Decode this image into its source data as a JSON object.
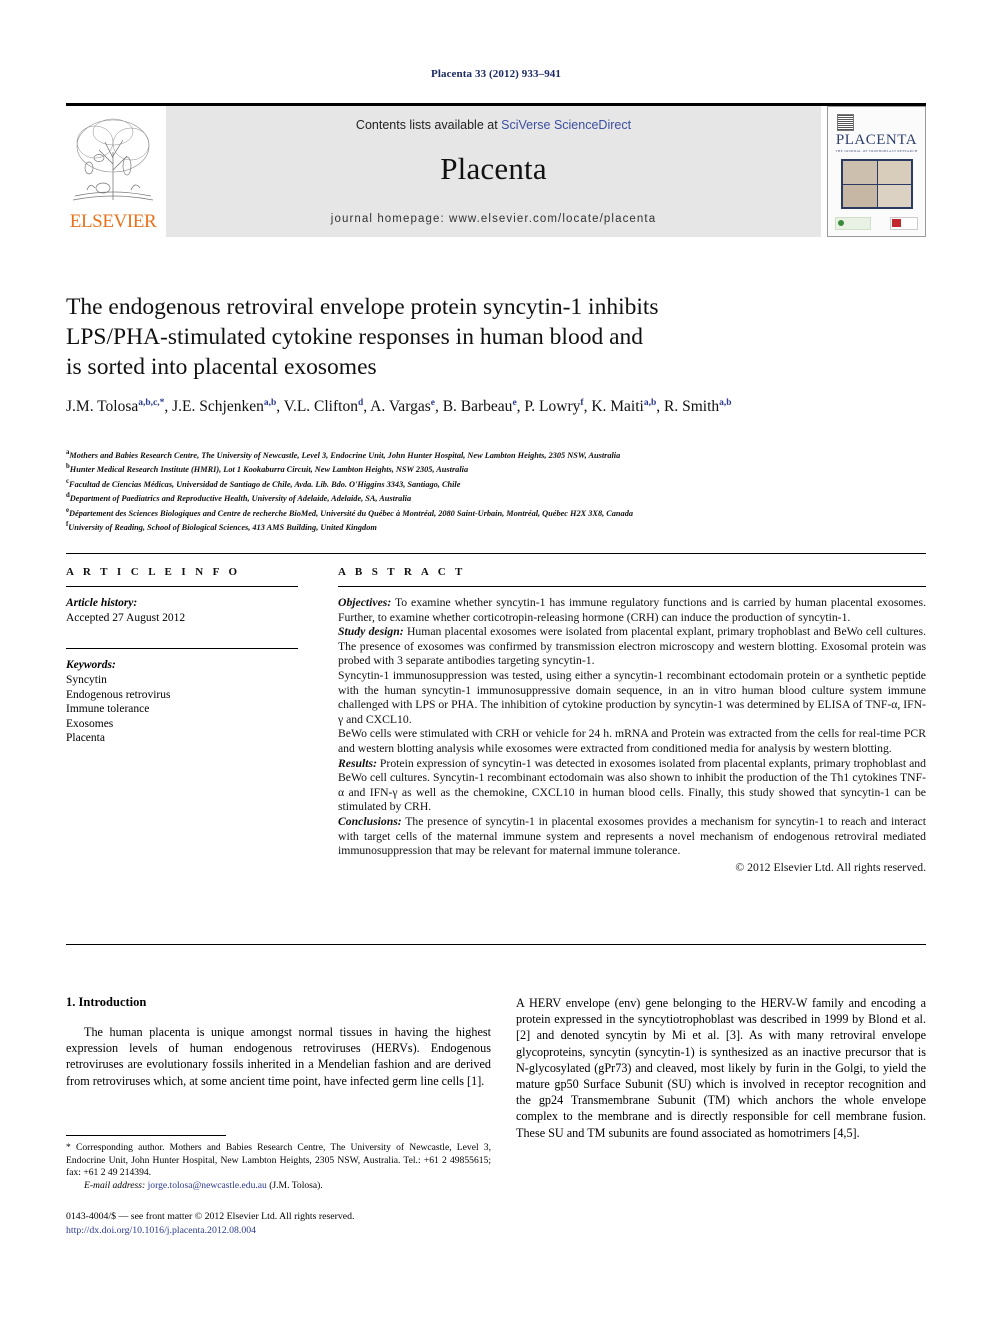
{
  "running_head": "Placenta 33 (2012) 933–941",
  "banner": {
    "publisher_name": "ELSEVIER",
    "contents_prefix": "Contents lists available at ",
    "contents_link": "SciVerse ScienceDirect",
    "journal_title": "Placenta",
    "homepage_line": "journal homepage: www.elsevier.com/locate/placenta",
    "cover_title": "PLACENTA",
    "cover_subtitle": "THE JOURNAL OF TROPHOBLAST RESEARCH"
  },
  "article": {
    "title_lines": [
      "The endogenous retroviral envelope protein syncytin-1 inhibits",
      "LPS/PHA-stimulated cytokine responses in human blood and",
      "is sorted into placental exosomes"
    ],
    "authors": [
      {
        "name": "J.M. Tolosa",
        "sup": "a,b,c,*"
      },
      {
        "name": "J.E. Schjenken",
        "sup": "a,b"
      },
      {
        "name": "V.L. Clifton",
        "sup": "d"
      },
      {
        "name": "A. Vargas",
        "sup": "e"
      },
      {
        "name": "B. Barbeau",
        "sup": "e"
      },
      {
        "name": "P. Lowry",
        "sup": "f"
      },
      {
        "name": "K. Maiti",
        "sup": "a,b"
      },
      {
        "name": "R. Smith",
        "sup": "a,b"
      }
    ],
    "affiliations": [
      {
        "mark": "a",
        "text": "Mothers and Babies Research Centre, The University of Newcastle, Level 3, Endocrine Unit, John Hunter Hospital, New Lambton Heights, 2305 NSW, Australia"
      },
      {
        "mark": "b",
        "text": "Hunter Medical Research Institute (HMRI), Lot 1 Kookaburra Circuit, New Lambton Heights, NSW 2305, Australia"
      },
      {
        "mark": "c",
        "text": "Facultad de Ciencias Médicas, Universidad de Santiago de Chile, Avda. Lib. Bdo. O'Higgins 3343, Santiago, Chile"
      },
      {
        "mark": "d",
        "text": "Department of Paediatrics and Reproductive Health, University of Adelaide, Adelaide, SA, Australia"
      },
      {
        "mark": "e",
        "text": "Département des Sciences Biologiques and Centre de recherche BioMed, Université du Québec à Montréal, 2080 Saint-Urbain, Montréal, Québec H2X 3X8, Canada"
      },
      {
        "mark": "f",
        "text": "University of Reading, School of Biological Sciences, 413 AMS Building, United Kingdom"
      }
    ]
  },
  "article_info": {
    "heading": "A R T I C L E  I N F O",
    "history_label": "Article history:",
    "history_value": "Accepted 27 August 2012",
    "keywords_label": "Keywords:",
    "keywords": [
      "Syncytin",
      "Endogenous retrovirus",
      "Immune tolerance",
      "Exosomes",
      "Placenta"
    ]
  },
  "abstract": {
    "heading": "A B S T R A C T",
    "paragraphs": [
      {
        "lead": "Objectives:",
        "text": " To examine whether syncytin-1 has immune regulatory functions and is carried by human placental exosomes. Further, to examine whether corticotropin-releasing hormone (CRH) can induce the production of syncytin-1."
      },
      {
        "lead": "Study design:",
        "text": " Human placental exosomes were isolated from placental explant, primary trophoblast and BeWo cell cultures. The presence of exosomes was confirmed by transmission electron microscopy and western blotting. Exosomal protein was probed with 3 separate antibodies targeting syncytin-1."
      },
      {
        "lead": "",
        "text": "Syncytin-1 immunosuppression was tested, using either a syncytin-1 recombinant ectodomain protein or a synthetic peptide with the human syncytin-1 immunosuppressive domain sequence, in an in vitro human blood culture system immune challenged with LPS or PHA. The inhibition of cytokine production by syncytin-1 was determined by ELISA of TNF-α, IFN-γ and CXCL10."
      },
      {
        "lead": "",
        "text": "BeWo cells were stimulated with CRH or vehicle for 24 h. mRNA and Protein was extracted from the cells for real-time PCR and western blotting analysis while exosomes were extracted from conditioned media for analysis by western blotting."
      },
      {
        "lead": "Results:",
        "text": " Protein expression of syncytin-1 was detected in exosomes isolated from placental explants, primary trophoblast and BeWo cell cultures. Syncytin-1 recombinant ectodomain was also shown to inhibit the production of the Th1 cytokines TNF-α and IFN-γ as well as the chemokine, CXCL10 in human blood cells. Finally, this study showed that syncytin-1 can be stimulated by CRH."
      },
      {
        "lead": "Conclusions:",
        "text": " The presence of syncytin-1 in placental exosomes provides a mechanism for syncytin-1 to reach and interact with target cells of the maternal immune system and represents a novel mechanism of endogenous retroviral mediated immunosuppression that may be relevant for maternal immune tolerance."
      }
    ],
    "copyright": "© 2012 Elsevier Ltd. All rights reserved."
  },
  "body": {
    "section_number_title": "1. Introduction",
    "left_paragraph": "The human placenta is unique amongst normal tissues in having the highest expression levels of human endogenous retroviruses (HERVs). Endogenous retroviruses are evolutionary fossils inherited in a Mendelian fashion and are derived from retroviruses which, at some ancient time point, have infected germ line cells [1].",
    "right_paragraph": "A HERV envelope (env) gene belonging to the HERV-W family and encoding a protein expressed in the syncytiotrophoblast was described in 1999 by Blond et al. [2] and denoted syncytin by Mi et al. [3]. As with many retroviral envelope glycoproteins, syncytin (syncytin-1) is synthesized as an inactive precursor that is N-glycosylated (gPr73) and cleaved, most likely by furin in the Golgi, to yield the mature gp50 Surface Subunit (SU) which is involved in receptor recognition and the gp24 Transmembrane Subunit (TM) which anchors the whole envelope complex to the membrane and is directly responsible for cell membrane fusion. These SU and TM subunits are found associated as homotrimers [4,5]."
  },
  "footnotes": {
    "corresponding": "* Corresponding author. Mothers and Babies Research Centre, The University of Newcastle, Level 3, Endocrine Unit, John Hunter Hospital, New Lambton Heights, 2305 NSW, Australia. Tel.: +61 2 49855615; fax: +61 2 49 214394.",
    "email_label": "E-mail address:",
    "email_link": "jorge.tolosa@newcastle.edu.au",
    "email_suffix": " (J.M. Tolosa).",
    "issn_line": "0143-4004/$ — see front matter © 2012 Elsevier Ltd. All rights reserved.",
    "doi_line": "http://dx.doi.org/10.1016/j.placenta.2012.08.004"
  },
  "colors": {
    "link": "#3b4fa0",
    "reference": "#2a3a8f",
    "header_navy": "#1b2a63",
    "elsevier_orange": "#e8721c",
    "banner_gray": "#e6e6e6"
  }
}
